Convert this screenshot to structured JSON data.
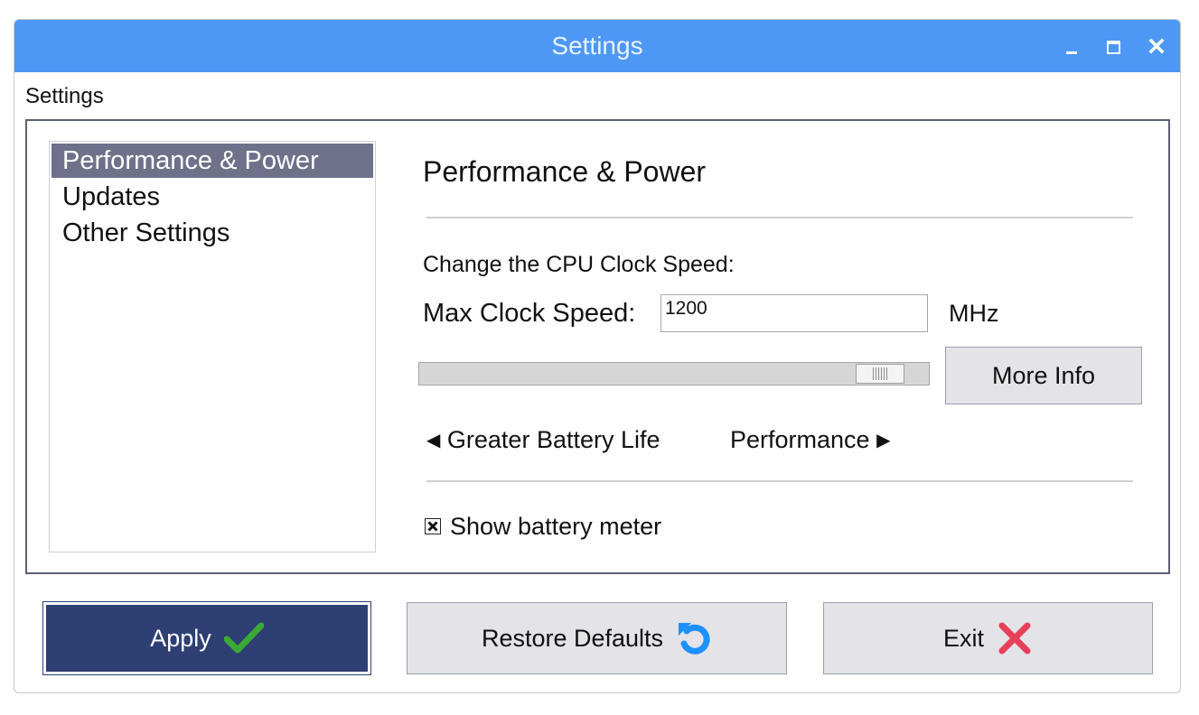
{
  "window": {
    "title": "Settings"
  },
  "menu": {
    "label": "Settings"
  },
  "sidebar": {
    "items": [
      {
        "label": "Performance & Power",
        "selected": true
      },
      {
        "label": "Updates",
        "selected": false
      },
      {
        "label": "Other Settings",
        "selected": false
      }
    ]
  },
  "content": {
    "title": "Performance & Power",
    "cpu_label": "Change the CPU Clock Speed:",
    "max_clock_label": "Max Clock Speed:",
    "max_clock_value": "1200",
    "unit": "MHz",
    "slider_level": 0.95,
    "more_info_label": "More Info",
    "battery_life_label": "Greater Battery Life",
    "performance_label": "Performance",
    "show_battery_meter_label": "Show battery meter",
    "show_battery_meter_checked": true
  },
  "footer": {
    "apply_label": "Apply",
    "restore_label": "Restore Defaults",
    "exit_label": "Exit"
  },
  "icons": {
    "check": "checkmark-icon",
    "restore": "restore-icon",
    "exit": "x-icon"
  },
  "colors": {
    "titlebar": "#4d98f5",
    "selected_item": "#6e7189",
    "apply_bg": "#2e3f74",
    "check_green": "#3aaa35",
    "restore_blue": "#1e90ff",
    "exit_red": "#e8405a"
  }
}
